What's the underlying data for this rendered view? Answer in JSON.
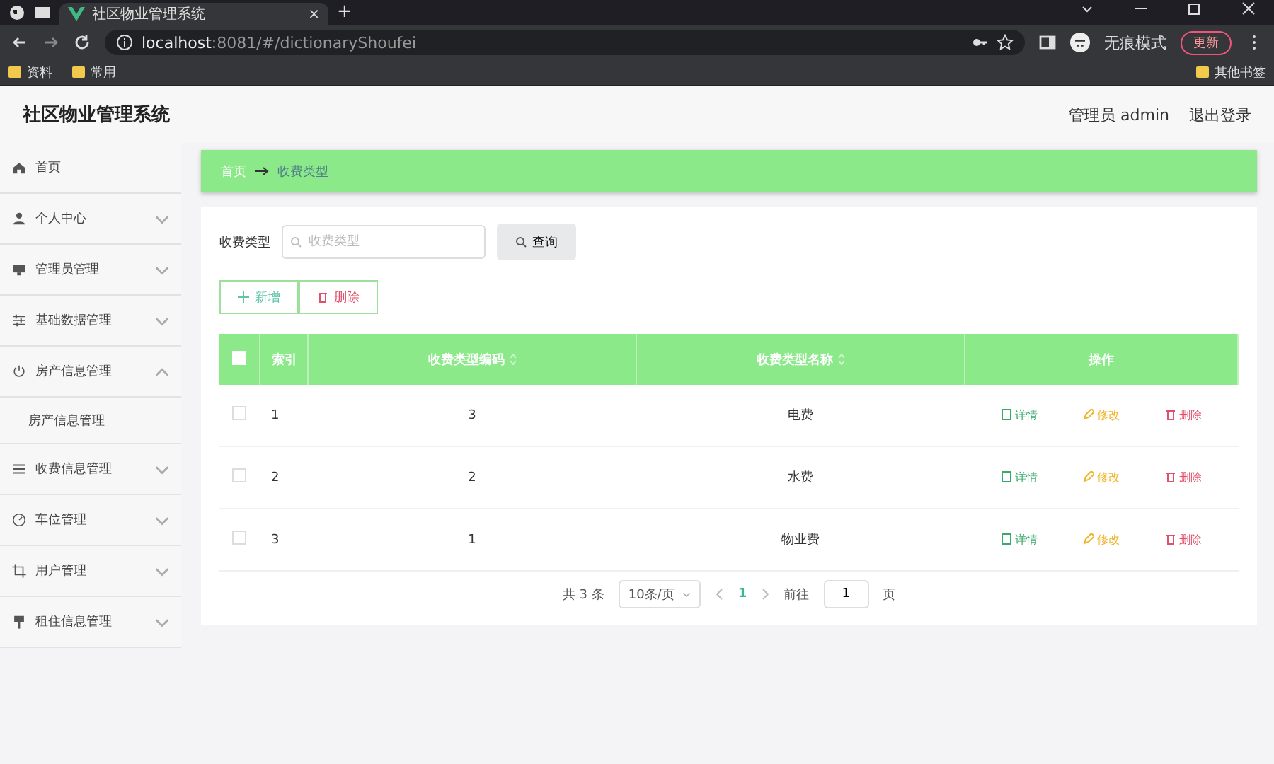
{
  "browser": {
    "tab": {
      "title": "社区物业管理系统",
      "close": "×"
    },
    "new_tab": "+",
    "url_host": "localhost",
    "url_rest": ":8081/#/dictionaryShoufei",
    "profile": "无痕模式",
    "update_button": "更新",
    "bookmarks": [
      "资料",
      "常用"
    ],
    "other_bookmarks": "其他书签"
  },
  "app": {
    "title": "社区物业管理系统",
    "user": "管理员 admin",
    "logout": "退出登录"
  },
  "sidebar": {
    "items": [
      {
        "label": "首页"
      },
      {
        "label": "个人中心",
        "expanded": false
      },
      {
        "label": "管理员管理",
        "expanded": false
      },
      {
        "label": "基础数据管理",
        "expanded": false
      },
      {
        "label": "房产信息管理",
        "expanded": true,
        "children": [
          {
            "label": "房产信息管理"
          }
        ]
      },
      {
        "label": "收费信息管理",
        "expanded": false
      },
      {
        "label": "车位管理",
        "expanded": false
      },
      {
        "label": "用户管理",
        "expanded": false
      },
      {
        "label": "租住信息管理",
        "expanded": false
      }
    ]
  },
  "breadcrumb": [
    "首页",
    "收费类型"
  ],
  "search": {
    "label": "收费类型",
    "placeholder": "收费类型",
    "button": "查询"
  },
  "actions": [
    {
      "label": "新增",
      "kind": "add"
    },
    {
      "label": "删除",
      "kind": "delete"
    }
  ],
  "table": {
    "select_all_checked": false,
    "columns": [
      {
        "label": "索引",
        "sortable": false
      },
      {
        "label": "收费类型编码",
        "sortable": true
      },
      {
        "label": "收费类型名称",
        "sortable": true
      },
      {
        "label": "操作",
        "sortable": false
      }
    ],
    "rows": [
      {
        "index": "1",
        "code": "3",
        "name": "电费",
        "checked": false,
        "actions": [
          {
            "label": "详情",
            "kind": "detail"
          },
          {
            "label": "修改",
            "kind": "edit"
          },
          {
            "label": "删除",
            "kind": "delete"
          }
        ]
      },
      {
        "index": "2",
        "code": "2",
        "name": "水费",
        "checked": false,
        "actions": [
          {
            "label": "详情",
            "kind": "detail"
          },
          {
            "label": "修改",
            "kind": "edit"
          },
          {
            "label": "删除",
            "kind": "delete"
          }
        ]
      },
      {
        "index": "3",
        "code": "1",
        "name": "物业费",
        "checked": false,
        "actions": [
          {
            "label": "详情",
            "kind": "detail"
          },
          {
            "label": "修改",
            "kind": "edit"
          },
          {
            "label": "删除",
            "kind": "delete"
          }
        ]
      }
    ]
  },
  "pagination": {
    "total": "共 3 条",
    "page_size": "10条/页",
    "pages": [
      {
        "label": "1",
        "selected": true
      }
    ],
    "goto_label": "前往",
    "goto_value": "1",
    "goto_suffix": "页"
  }
}
